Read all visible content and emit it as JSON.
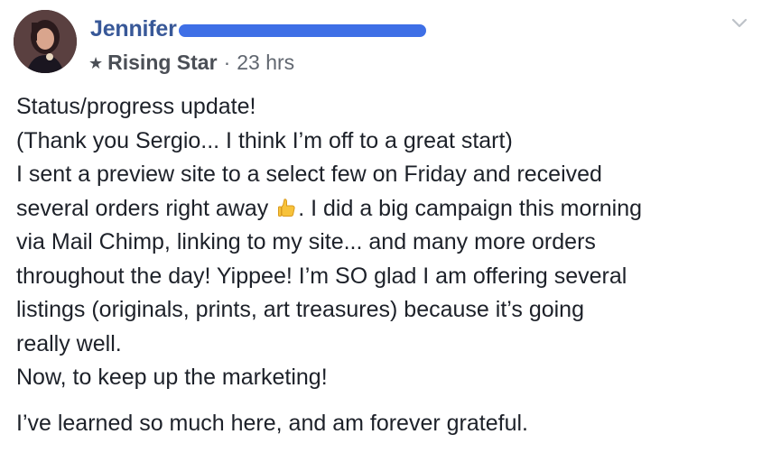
{
  "post": {
    "author": {
      "first_name": "Jennifer",
      "avatar_icon": "profile-photo"
    },
    "meta": {
      "badge_icon": "star-icon",
      "badge": "Rising Star",
      "separator": "·",
      "time": "23 hrs"
    },
    "menu_icon": "chevron-down-icon",
    "body": {
      "line1": "Status/progress update!",
      "line2": "(Thank you Sergio... I think I’m off to a great start)",
      "line3": "I sent a preview site to a select few on Friday and received",
      "line4_before_emoji": "several orders right away ",
      "emoji_icon": "thumbs-up-emoji",
      "line4_after_emoji": ". I did a big campaign this morning",
      "line5": "via Mail Chimp, linking to my site... and many more orders",
      "line6": "throughout the day! Yippee! I’m SO glad I am offering several",
      "line7": "listings (originals, prints, art treasures) because it’s going",
      "line8": "really well.",
      "line9": "Now, to keep up the marketing!",
      "paragraph2": "I’ve learned so much here, and am forever grateful."
    },
    "colors": {
      "author_blue": "#385898",
      "redaction_blue": "#3e6fe6",
      "text": "#1d2129",
      "meta_gray": "#616770"
    }
  }
}
